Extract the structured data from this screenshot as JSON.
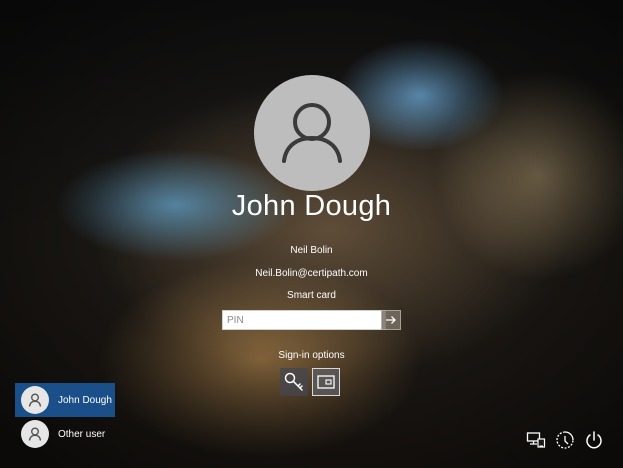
{
  "screen": "lock-screen-sign-in",
  "user": {
    "display_name": "John Dough",
    "account_name": "Neil Bolin",
    "email": "Neil.Bolin@certipath.com",
    "credential_type": "Smart card"
  },
  "pin": {
    "placeholder": "PIN",
    "value": ""
  },
  "sign_in_options": {
    "label": "Sign-in options",
    "options": [
      {
        "name": "security-key",
        "icon": "key-icon",
        "selected": false
      },
      {
        "name": "smart-card",
        "icon": "smart-card-icon",
        "selected": true
      }
    ]
  },
  "user_list": [
    {
      "label": "John Dough",
      "selected": true
    },
    {
      "label": "Other user",
      "selected": false
    }
  ],
  "system_tray": [
    "network-icon",
    "ease-of-access-icon",
    "power-icon"
  ],
  "colors": {
    "selected_tile": "#1a4f8a",
    "avatar_bg": "#bdbdbd",
    "text": "#ffffff"
  }
}
